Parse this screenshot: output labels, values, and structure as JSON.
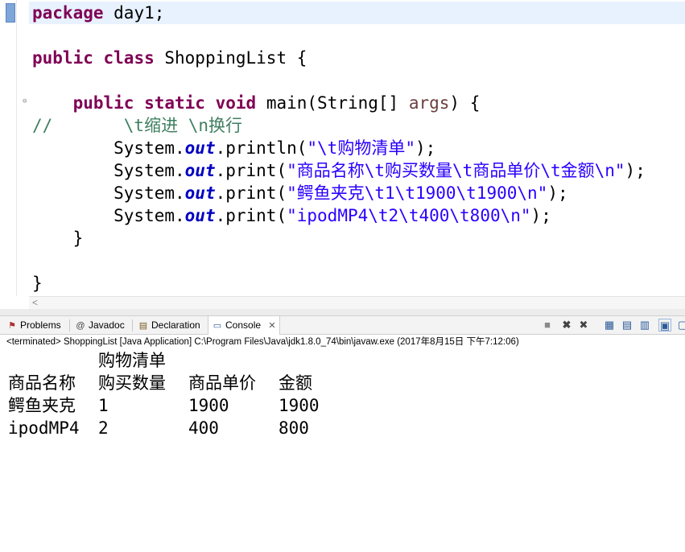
{
  "editor": {
    "line1": {
      "kw": "package",
      "rest": " day1;"
    },
    "line2": {
      "kw1": "public",
      "kw2": "class",
      "rest": " ShoppingList {"
    },
    "line3": {
      "kw1": "public",
      "kw2": "static",
      "kw3": "void",
      "name": " main(String[] ",
      "param": "args",
      "end": ") {"
    },
    "comment": "//       \\t缩进 \\n换行",
    "stmt1": {
      "prefix": "        System.",
      "field": "out",
      "method": ".println(",
      "string": "\"\\t购物清单\"",
      "end": ");"
    },
    "stmt2": {
      "prefix": "        System.",
      "field": "out",
      "method": ".print(",
      "string": "\"商品名称\\t购买数量\\t商品单价\\t金额\\n\"",
      "end": ");"
    },
    "stmt3": {
      "prefix": "        System.",
      "field": "out",
      "method": ".print(",
      "string": "\"鳄鱼夹克\\t1\\t1900\\t1900\\n\"",
      "end": ");"
    },
    "stmt4": {
      "prefix": "        System.",
      "field": "out",
      "method": ".print(",
      "string": "\"ipodMP4\\t2\\t400\\t800\\n\"",
      "end": ");"
    },
    "close_method": "    }",
    "close_class": "}",
    "fold_marker": "⊖",
    "scroll_left": "<"
  },
  "tabs": [
    {
      "label": "Problems",
      "icon": "problems-icon"
    },
    {
      "label": "Javadoc",
      "icon": "javadoc-icon"
    },
    {
      "label": "Declaration",
      "icon": "declaration-icon"
    },
    {
      "label": "Console",
      "icon": "console-icon",
      "close": "✕"
    }
  ],
  "status_line": "<terminated> ShoppingList [Java Application] C:\\Program Files\\Java\\jdk1.8.0_74\\bin\\javaw.exe (2017年8月15日 下午7:12:06)",
  "console_output": {
    "title": "购物清单",
    "header": [
      "商品名称",
      "购买数量",
      "商品单价",
      "金额"
    ],
    "rows": [
      [
        "鳄鱼夹克",
        "1",
        "1900",
        "1900"
      ],
      [
        "ipodMP4",
        "2",
        "400",
        "800"
      ]
    ]
  },
  "colors": {
    "keyword": "#7f0055",
    "string": "#2a00ff",
    "comment": "#3f7f5f",
    "static_field": "#0000c0"
  }
}
